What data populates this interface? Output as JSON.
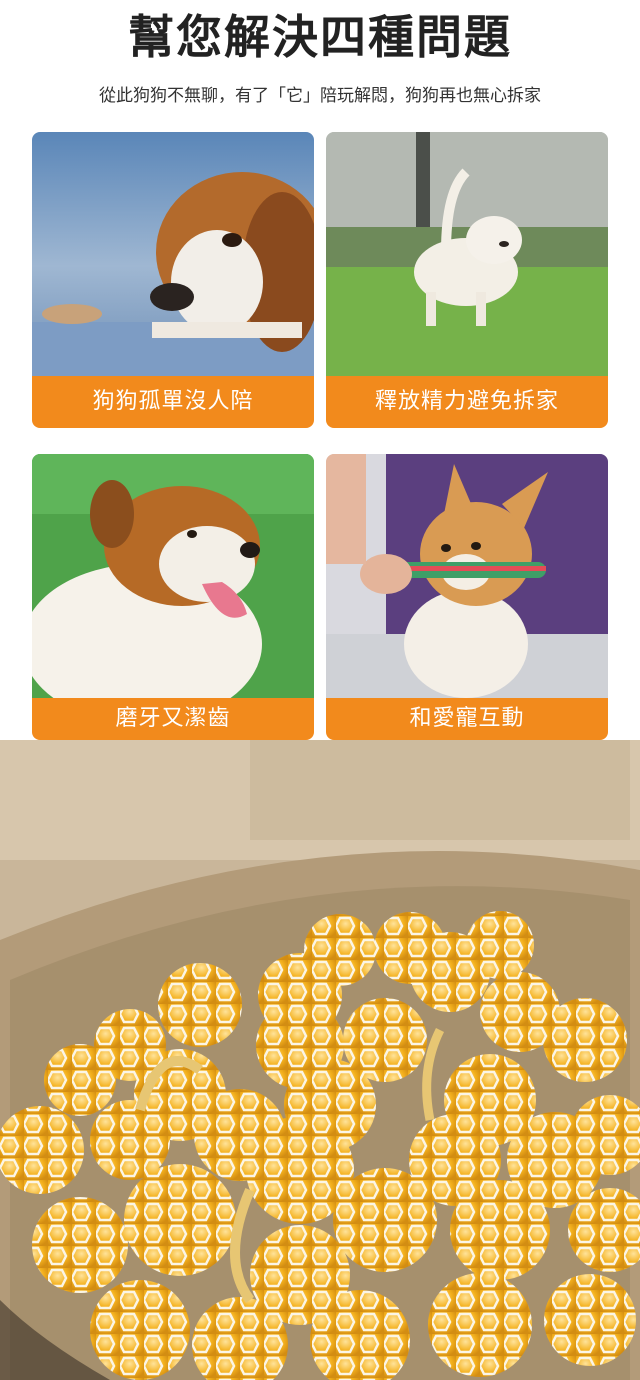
{
  "header": {
    "title": "幫您解決四種問題",
    "subtitle": "從此狗狗不無聊，有了「它」陪玩解悶，狗狗再也無心拆家"
  },
  "cards": [
    {
      "label": "狗狗孤單沒人陪",
      "image": "beagle-resting-photo"
    },
    {
      "label": "釋放精力避免拆家",
      "image": "puppy-running-on-grass-photo"
    },
    {
      "label": "磨牙又潔齒",
      "image": "collie-tongue-out-photo"
    },
    {
      "label": "和愛寵互動",
      "image": "corgi-with-rope-toy-photo"
    }
  ],
  "colors": {
    "accent": "#f28a1c",
    "ball": "#f4b11e"
  },
  "bottom_photo": "cardboard-box-of-yellow-toy-balls-photo"
}
